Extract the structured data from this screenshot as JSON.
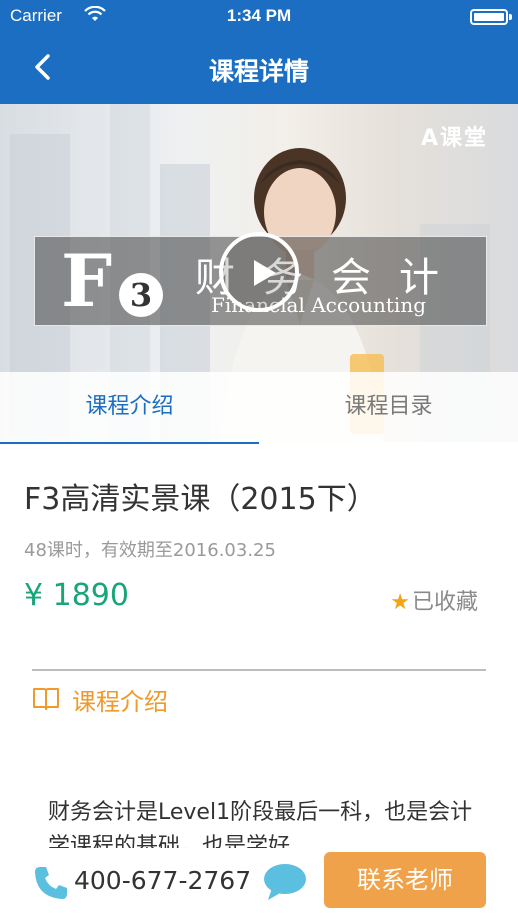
{
  "status_bar": {
    "carrier": "Carrier",
    "time": "1:34 PM"
  },
  "nav": {
    "title": "课程详情",
    "back_icon": "chevron-left-icon"
  },
  "hero": {
    "brand": "A课堂",
    "course_code_letter": "F",
    "course_code_number": "3",
    "subject_cn": "财务会计",
    "subject_en": "Financial Accounting",
    "play_icon": "play-icon"
  },
  "tabs": [
    {
      "label": "课程介绍",
      "active": true
    },
    {
      "label": "课程目录",
      "active": false
    }
  ],
  "course": {
    "title": "F3高清实景课（2015下）",
    "meta": "48课时，有效期至2016.03.25",
    "price": "¥ 1890",
    "favorite_label": "已收藏",
    "favorite_icon": "star-icon"
  },
  "section": {
    "title": "课程介绍",
    "icon": "book-icon"
  },
  "description": "财务会计是Level1阶段最后一科，也是会计学课程的基础，也是学好",
  "bottom_bar": {
    "phone": "400-677-2767",
    "phone_icon": "phone-icon",
    "chat_icon": "chat-bubble-icon",
    "contact_button": "联系老师"
  },
  "colors": {
    "primary": "#1b6ec2",
    "price": "#1aa47a",
    "accent": "#ef9a2a",
    "button": "#f0a24a",
    "icon_blue": "#5bbfe0",
    "star": "#f2a516"
  }
}
